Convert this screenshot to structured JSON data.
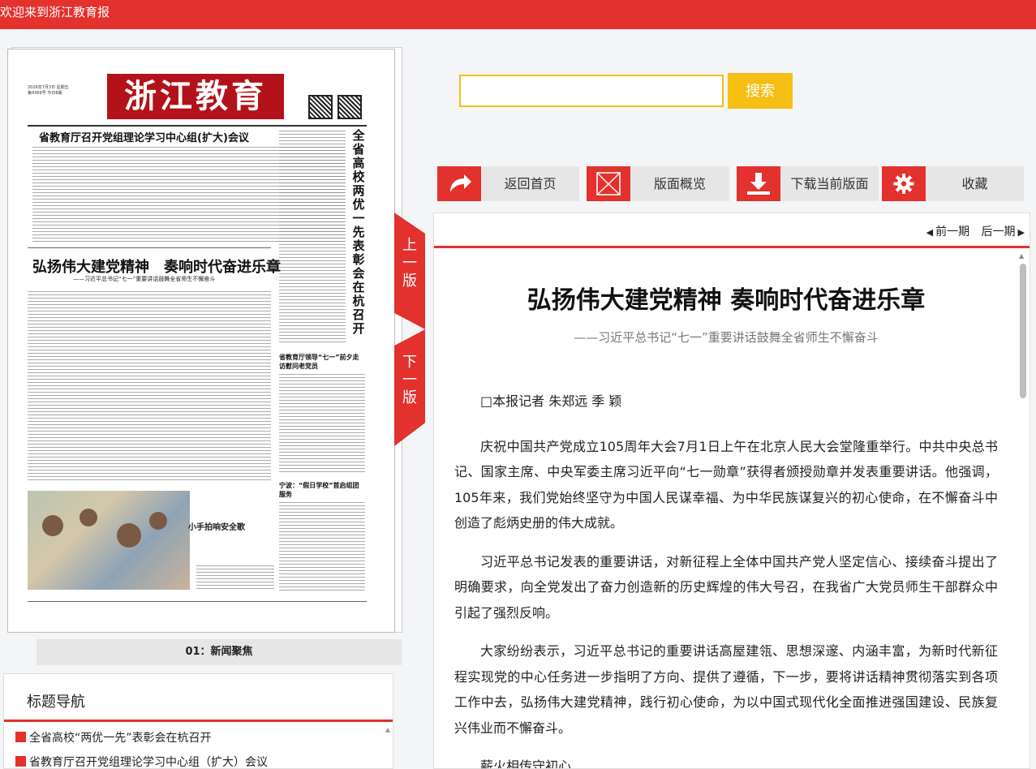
{
  "topbar": {
    "welcome": "欢迎来到浙江教育报"
  },
  "newspaper": {
    "date_line": "2026年7月3日 星期五",
    "issue_line": "第4369号 今日8版",
    "masthead": "浙江教育报",
    "headline1": "省教育厅召开党组理论学习中心组(扩大)会议",
    "vertical_headline": "全省高校两优一先表彰会在杭召开",
    "headline2": "弘扬伟大建党精神　奏响时代奋进乐章",
    "subheadline2": "——习近平总书记“七一”重要讲话鼓舞全省师生不懈奋斗",
    "headline3": "省教育厅领导“七一”前夕走访慰问老党员",
    "headline4": "宁波：“假日学校”首启组团服务",
    "photo_caption": "小手拍响安全歌",
    "page_label": "01：新闻聚焦"
  },
  "page_tabs": {
    "prev": "上一版",
    "next": "下一版"
  },
  "title_nav": {
    "heading": "标题导航",
    "items": [
      "全省高校“两优一先”表彰会在杭召开",
      "省教育厅召开党组理论学习中心组（扩大）会议"
    ]
  },
  "search": {
    "value": "",
    "placeholder": "",
    "button": "搜索"
  },
  "toolbar": {
    "home": "返回首页",
    "overview": "版面概览",
    "download": "下载当前版面",
    "favorite": "收藏"
  },
  "issue_nav": {
    "prev": "前一期",
    "next": "后一期"
  },
  "article": {
    "title": "弘扬伟大建党精神 奏响时代奋进乐章",
    "subtitle": "——习近平总书记“七一”重要讲话鼓舞全省师生不懈奋斗",
    "author": "□本报记者  朱郑远  季  颖",
    "paragraphs": [
      "庆祝中国共产党成立105周年大会7月1日上午在北京人民大会堂隆重举行。中共中央总书记、国家主席、中央军委主席习近平向“七一勋章”获得者颁授勋章并发表重要讲话。他强调，105年来，我们党始终坚守为中国人民谋幸福、为中华民族谋复兴的初心使命，在不懈奋斗中创造了彪炳史册的伟大成就。",
      "习近平总书记发表的重要讲话，对新征程上全体中国共产党人坚定信心、接续奋斗提出了明确要求，向全党发出了奋力创造新的历史辉煌的伟大号召，在我省广大党员师生干部群众中引起了强烈反响。",
      "大家纷纷表示，习近平总书记的重要讲话高屋建瓴、思想深邃、内涵丰富，为新时代新征程实现党的中心任务进一步指明了方向、提供了遵循，下一步，要将讲话精神贯彻落实到各项工作中去，弘扬伟大建党精神，践行初心使命，为以中国式现代化全面推进强国建设、民族复兴伟业而不懈奋斗。",
      "薪火相传守初心"
    ]
  },
  "colors": {
    "brand_red": "#e3312d",
    "search_yellow": "#f5bf13"
  }
}
